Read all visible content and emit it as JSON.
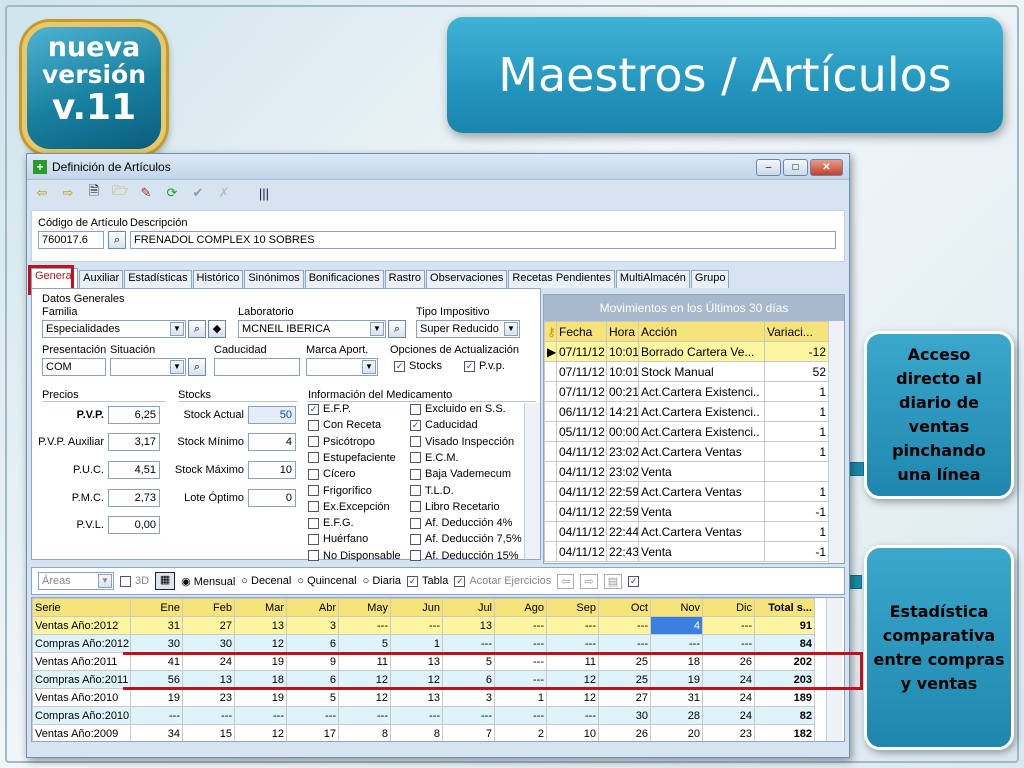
{
  "badge": {
    "line1": "nueva",
    "line2": "versión",
    "line3": "v.11"
  },
  "slide_title": "Maestros / Artículos",
  "callouts": {
    "top": "Acceso directo al diario de ventas pinchando una línea",
    "bottom": "Estadística comparativa entre compras y ventas"
  },
  "window": {
    "title": "Definición de Artículos",
    "buttons": {
      "minimize": "‒",
      "maximize": "□",
      "close": "✕"
    },
    "toolbar": [
      "⇦",
      "⇨",
      "🗎",
      "🗁",
      "✎",
      "⟳",
      "✔",
      "✗",
      "|||"
    ],
    "code_label": "Código de Artículo",
    "desc_label": "Descripción",
    "code_value": "760017.6",
    "desc_value": "FRENADOL COMPLEX 10 SOBRES",
    "tabs": [
      "General",
      "Auxiliar",
      "Estadísticas",
      "Histórico",
      "Sinónimos",
      "Bonificaciones",
      "Rastro",
      "Observaciones",
      "Recetas Pendientes",
      "MultiAlmacén",
      "Grupo"
    ],
    "general": {
      "datos_label": "Datos Generales",
      "familia_label": "Familia",
      "familia_value": "Especialidades",
      "laboratorio_label": "Laboratorio",
      "laboratorio_value": "MCNEIL IBERICA",
      "tipo_label": "Tipo Impositivo",
      "tipo_value": "Super Reducido",
      "presentacion_label": "Presentación",
      "presentacion_value": "COM",
      "situacion_label": "Situación",
      "situacion_value": "",
      "caducidad_label": "Caducidad",
      "caducidad_value": "",
      "marca_label": "Marca Aport.",
      "marca_value": "",
      "opciones_label": "Opciones de Actualización",
      "opt_stocks": "Stocks",
      "opt_pvp": "P.v.p."
    },
    "precios": {
      "label": "Precios",
      "rows": [
        {
          "name": "P.V.P.",
          "value": "6,25"
        },
        {
          "name": "P.V.P. Auxiliar",
          "value": "3,17"
        },
        {
          "name": "P.U.C.",
          "value": "4,51"
        },
        {
          "name": "P.M.C.",
          "value": "2,73"
        },
        {
          "name": "P.V.L.",
          "value": "0,00"
        }
      ]
    },
    "stocks": {
      "label": "Stocks",
      "rows": [
        {
          "name": "Stock Actual",
          "value": "50"
        },
        {
          "name": "Stock Mínimo",
          "value": "4"
        },
        {
          "name": "Stock Máximo",
          "value": "10"
        },
        {
          "name": "Lote Óptimo",
          "value": "0"
        }
      ]
    },
    "medicamento": {
      "label": "Información del Medicamento",
      "col1": [
        {
          "t": "E.F.P.",
          "c": true
        },
        {
          "t": "Con Receta",
          "c": false
        },
        {
          "t": "Psicótropo",
          "c": false
        },
        {
          "t": "Estupefaciente",
          "c": false
        },
        {
          "t": "Cícero",
          "c": false
        },
        {
          "t": "Frigorífico",
          "c": false
        },
        {
          "t": "Ex.Excepción",
          "c": false
        },
        {
          "t": "E.F.G.",
          "c": false
        },
        {
          "t": "Huérfano",
          "c": false
        },
        {
          "t": "No Disponsable",
          "c": false
        }
      ],
      "col2": [
        {
          "t": "Excluido en S.S.",
          "c": false
        },
        {
          "t": "Caducidad",
          "c": true
        },
        {
          "t": "Visado Inspección",
          "c": false
        },
        {
          "t": "E.C.M.",
          "c": false
        },
        {
          "t": "Baja Vademecum",
          "c": false
        },
        {
          "t": "T.L.D.",
          "c": false
        },
        {
          "t": "Libro Recetario",
          "c": false
        },
        {
          "t": "Af. Deducción 4%",
          "c": false
        },
        {
          "t": "Af. Deducción 7,5%",
          "c": false
        },
        {
          "t": "Af. Deducción 15%",
          "c": false
        }
      ]
    },
    "movimientos": {
      "title": "Movimientos en los Últimos 30 días",
      "headers": [
        "Fecha",
        "Hora",
        "Acción",
        "Variaci..."
      ],
      "rows": [
        [
          "07/11/12",
          "10:01",
          "Borrado Cartera Ve...",
          "-12"
        ],
        [
          "07/11/12",
          "10:01",
          "Stock Manual",
          "52"
        ],
        [
          "07/11/12",
          "00:21",
          "Act.Cartera Existenci..",
          "1"
        ],
        [
          "06/11/12",
          "14:21",
          "Act.Cartera Existenci..",
          "1"
        ],
        [
          "05/11/12",
          "00:00",
          "Act.Cartera Existenci..",
          "1"
        ],
        [
          "04/11/12",
          "23:02",
          "Act.Cartera Ventas",
          "1"
        ],
        [
          "04/11/12",
          "23:02",
          "Venta",
          ""
        ],
        [
          "04/11/12",
          "22:59",
          "Act.Cartera Ventas",
          "1"
        ],
        [
          "04/11/12",
          "22:59",
          "Venta",
          "-1"
        ],
        [
          "04/11/12",
          "22:44",
          "Act.Cartera Ventas",
          "1"
        ],
        [
          "04/11/12",
          "22:43",
          "Venta",
          "-1"
        ]
      ]
    },
    "stat_toolbar": {
      "areas": "Áreas",
      "d3": "3D",
      "mensual": "Mensual",
      "decenal": "Decenal",
      "quincenal": "Quincenal",
      "diaria": "Diaria",
      "tabla": "Tabla",
      "acotar": "Acotar Ejercicios"
    },
    "estadistica": {
      "headers": [
        "Serie",
        "Ene",
        "Feb",
        "Mar",
        "Abr",
        "May",
        "Jun",
        "Jul",
        "Ago",
        "Sep",
        "Oct",
        "Nov",
        "Dic",
        "Total s..."
      ],
      "rows": [
        {
          "k": "hl",
          "cells": [
            "Ventas Año:2012",
            "31",
            "27",
            "13",
            "3",
            "---",
            "---",
            "13",
            "---",
            "---",
            "---",
            "4",
            "---",
            "91"
          ]
        },
        {
          "k": "c",
          "cells": [
            "Compras Año:2012",
            "30",
            "30",
            "12",
            "6",
            "5",
            "1",
            "---",
            "---",
            "---",
            "---",
            "---",
            "---",
            "84"
          ]
        },
        {
          "k": "v",
          "cells": [
            "Ventas Año:2011",
            "41",
            "24",
            "19",
            "9",
            "11",
            "13",
            "5",
            "---",
            "11",
            "25",
            "18",
            "26",
            "202"
          ]
        },
        {
          "k": "c",
          "cells": [
            "Compras Año:2011",
            "56",
            "13",
            "18",
            "6",
            "12",
            "12",
            "6",
            "---",
            "12",
            "25",
            "19",
            "24",
            "203"
          ]
        },
        {
          "k": "v",
          "cells": [
            "Ventas Año:2010",
            "19",
            "23",
            "19",
            "5",
            "12",
            "13",
            "3",
            "1",
            "12",
            "27",
            "31",
            "24",
            "189"
          ]
        },
        {
          "k": "c",
          "cells": [
            "Compras Año:2010",
            "---",
            "---",
            "---",
            "---",
            "---",
            "---",
            "---",
            "---",
            "---",
            "30",
            "28",
            "24",
            "82"
          ]
        },
        {
          "k": "v",
          "cells": [
            "Ventas Año:2009",
            "34",
            "15",
            "12",
            "17",
            "8",
            "8",
            "7",
            "2",
            "10",
            "26",
            "20",
            "23",
            "182"
          ]
        }
      ]
    }
  }
}
